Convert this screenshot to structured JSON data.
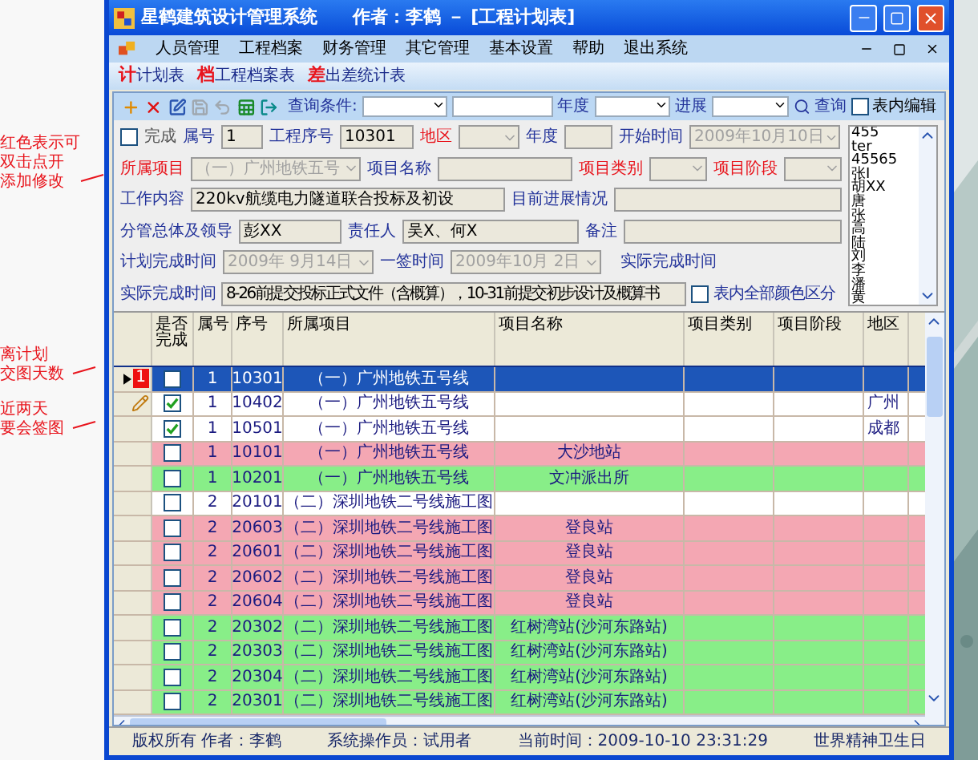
{
  "window": {
    "title": "星鹤建筑设计管理系统　　作者：李鹤 － [工程计划表]"
  },
  "menu": [
    "人员管理",
    "工程档案",
    "财务管理",
    "其它管理",
    "基本设置",
    "帮助",
    "退出系统"
  ],
  "quick_tabs": [
    {
      "glyph": "计",
      "label": "计划表"
    },
    {
      "glyph": "档",
      "label": "工程档案表"
    },
    {
      "glyph": "差",
      "label": "出差统计表"
    }
  ],
  "toolbar": {
    "icons": [
      {
        "kind": "add",
        "disabled": false
      },
      {
        "kind": "delete",
        "disabled": false
      },
      {
        "kind": "edit",
        "disabled": false
      },
      {
        "kind": "save",
        "disabled": true
      },
      {
        "kind": "undo",
        "disabled": true
      },
      {
        "kind": "excel",
        "disabled": false
      },
      {
        "kind": "exit",
        "disabled": false
      }
    ],
    "query_label": "查询条件:",
    "year_label": "年度",
    "progress_label": "进展",
    "search_button": "查询",
    "inline_edit": {
      "label": "表内编辑",
      "checked": false
    }
  },
  "form": {
    "done": {
      "label": "完成",
      "checked": false
    },
    "group_no": {
      "label": "属号",
      "value": "1"
    },
    "seq": {
      "label": "工程序号",
      "value": "10301"
    },
    "region": {
      "label": "地区",
      "highlight": true
    },
    "year": {
      "label": "年度"
    },
    "start": {
      "label": "开始时间",
      "value": "2009年10月10日",
      "disabled": true
    },
    "project": {
      "label": "所属项目",
      "highlight": true,
      "value": "（一）广州地铁五号",
      "disabled": true
    },
    "name": {
      "label": "项目名称"
    },
    "category": {
      "label": "项目类别",
      "highlight": true
    },
    "stage": {
      "label": "项目阶段",
      "highlight": true
    },
    "content": {
      "label": "工作内容",
      "value": "220kv航缆电力隧道联合投标及初设"
    },
    "progress": {
      "label": "目前进展情况"
    },
    "leader": {
      "label": "分管总体及领导",
      "value": "彭XX"
    },
    "owner": {
      "label": "责任人",
      "value": "吴X、何X"
    },
    "note": {
      "label": "备注"
    },
    "plan_date": {
      "label": "计划完成时间",
      "value": "2009年 9月14日",
      "disabled": true
    },
    "sign_date": {
      "label": "一签时间",
      "value": "2009年10月 2日",
      "disabled": true
    },
    "actual_label": "实际完成时间",
    "actual": {
      "label": "实际完成时间",
      "value": "8-26前提交投标正式文件（含概算），10-31前提交初步设计及概算书"
    },
    "color_all": {
      "label": "表内全部颜色区分",
      "checked": false
    },
    "people": [
      "455",
      "ter",
      "45565",
      "张I",
      "胡XX",
      "唐",
      "张",
      "高",
      "陆",
      "刘",
      "李",
      "潘",
      "黄"
    ]
  },
  "annotations": [
    {
      "lines": [
        "红色表示可",
        "双击点开",
        "添加修改"
      ]
    },
    {
      "lines": [
        "离计划",
        "交图天数"
      ]
    },
    {
      "lines": [
        "近两天",
        "要会签图"
      ]
    }
  ],
  "grid": {
    "columns": [
      "是否完成",
      "属号",
      "序号",
      "所属项目",
      "项目名称",
      "项目类别",
      "项目阶段",
      "地区"
    ],
    "rows": [
      {
        "selected": true,
        "color": "#1d56b8",
        "marker": {
          "kind": "days",
          "text": "1"
        },
        "done": false,
        "cells": [
          "",
          "1",
          "10301",
          "（一）广州地铁五号线",
          "",
          "",
          "",
          ""
        ]
      },
      {
        "selected": false,
        "color": "#ffffff",
        "marker": {
          "kind": "pencil"
        },
        "done": true,
        "cells": [
          "",
          "1",
          "10402",
          "（一）广州地铁五号线",
          "",
          "",
          "",
          "广州"
        ]
      },
      {
        "selected": false,
        "color": "#ffffff",
        "done": true,
        "cells": [
          "",
          "1",
          "10501",
          "（一）广州地铁五号线",
          "",
          "",
          "",
          "成都"
        ]
      },
      {
        "selected": false,
        "color": "#f4a7b3",
        "done": false,
        "cells": [
          "",
          "1",
          "10101",
          "（一）广州地铁五号线",
          "大沙地站",
          "",
          "",
          ""
        ]
      },
      {
        "selected": false,
        "color": "#88ee88",
        "done": false,
        "cells": [
          "",
          "1",
          "10201",
          "（一）广州地铁五号线",
          "文冲派出所",
          "",
          "",
          ""
        ]
      },
      {
        "selected": false,
        "color": "#ffffff",
        "done": false,
        "cells": [
          "",
          "2",
          "20101",
          "（二）深圳地铁二号线施工图",
          "",
          "",
          "",
          ""
        ]
      },
      {
        "selected": false,
        "color": "#f4a7b3",
        "done": false,
        "cells": [
          "",
          "2",
          "20603",
          "（二）深圳地铁二号线施工图",
          "登良站",
          "",
          "",
          ""
        ]
      },
      {
        "selected": false,
        "color": "#f4a7b3",
        "done": false,
        "cells": [
          "",
          "2",
          "20601",
          "（二）深圳地铁二号线施工图",
          "登良站",
          "",
          "",
          ""
        ]
      },
      {
        "selected": false,
        "color": "#f4a7b3",
        "done": false,
        "cells": [
          "",
          "2",
          "20602",
          "（二）深圳地铁二号线施工图",
          "登良站",
          "",
          "",
          ""
        ]
      },
      {
        "selected": false,
        "color": "#f4a7b3",
        "done": false,
        "cells": [
          "",
          "2",
          "20604",
          "（二）深圳地铁二号线施工图",
          "登良站",
          "",
          "",
          ""
        ]
      },
      {
        "selected": false,
        "color": "#88ee88",
        "done": false,
        "cells": [
          "",
          "2",
          "20302",
          "（二）深圳地铁二号线施工图",
          "红树湾站(沙河东路站)",
          "",
          "",
          ""
        ]
      },
      {
        "selected": false,
        "color": "#88ee88",
        "done": false,
        "cells": [
          "",
          "2",
          "20303",
          "（二）深圳地铁二号线施工图",
          "红树湾站(沙河东路站)",
          "",
          "",
          ""
        ]
      },
      {
        "selected": false,
        "color": "#88ee88",
        "done": false,
        "cells": [
          "",
          "2",
          "20304",
          "（二）深圳地铁二号线施工图",
          "红树湾站(沙河东路站)",
          "",
          "",
          ""
        ]
      },
      {
        "selected": false,
        "color": "#88ee88",
        "done": false,
        "cells": [
          "",
          "2",
          "20301",
          "（二）深圳地铁二号线施工图",
          "红树湾站(沙河东路站)",
          "",
          "",
          ""
        ]
      }
    ]
  },
  "status_bar": [
    "版权所有 作者：李鹤",
    "系统操作员：试用者",
    "当前时间：2009-10-10 23:31:29",
    "世界精神卫生日"
  ]
}
